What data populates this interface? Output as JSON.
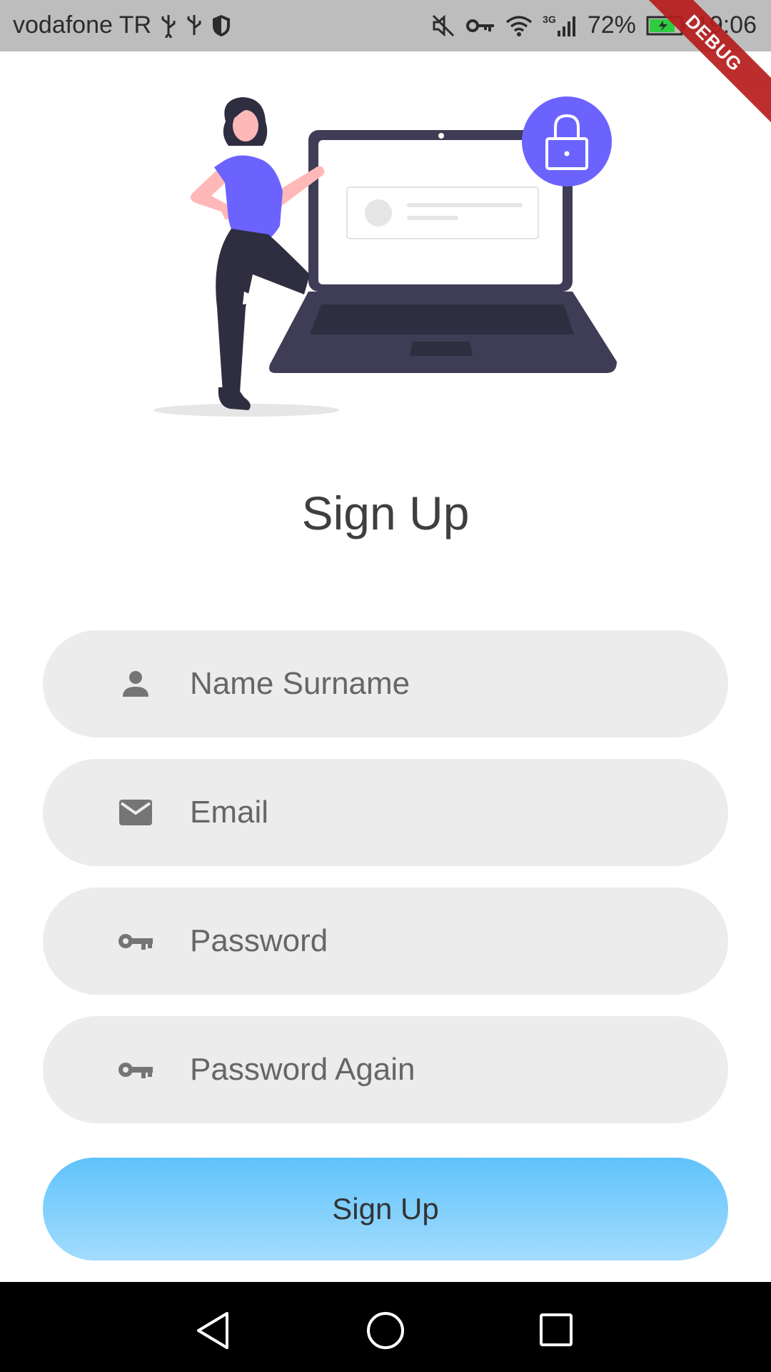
{
  "status_bar": {
    "carrier": "vodafone TR",
    "network": "3G",
    "battery": "72%",
    "time": "19:06"
  },
  "debug_banner": "DEBUG",
  "page": {
    "title": "Sign Up"
  },
  "form": {
    "name_placeholder": "Name Surname",
    "email_placeholder": "Email",
    "password_placeholder": "Password",
    "password_again_placeholder": "Password Again",
    "submit_label": "Sign Up"
  },
  "colors": {
    "accent_purple": "#6c63ff",
    "button_gradient_top": "#5fc3fb",
    "button_gradient_bottom": "#a3dcfd",
    "field_bg": "#ececec"
  }
}
